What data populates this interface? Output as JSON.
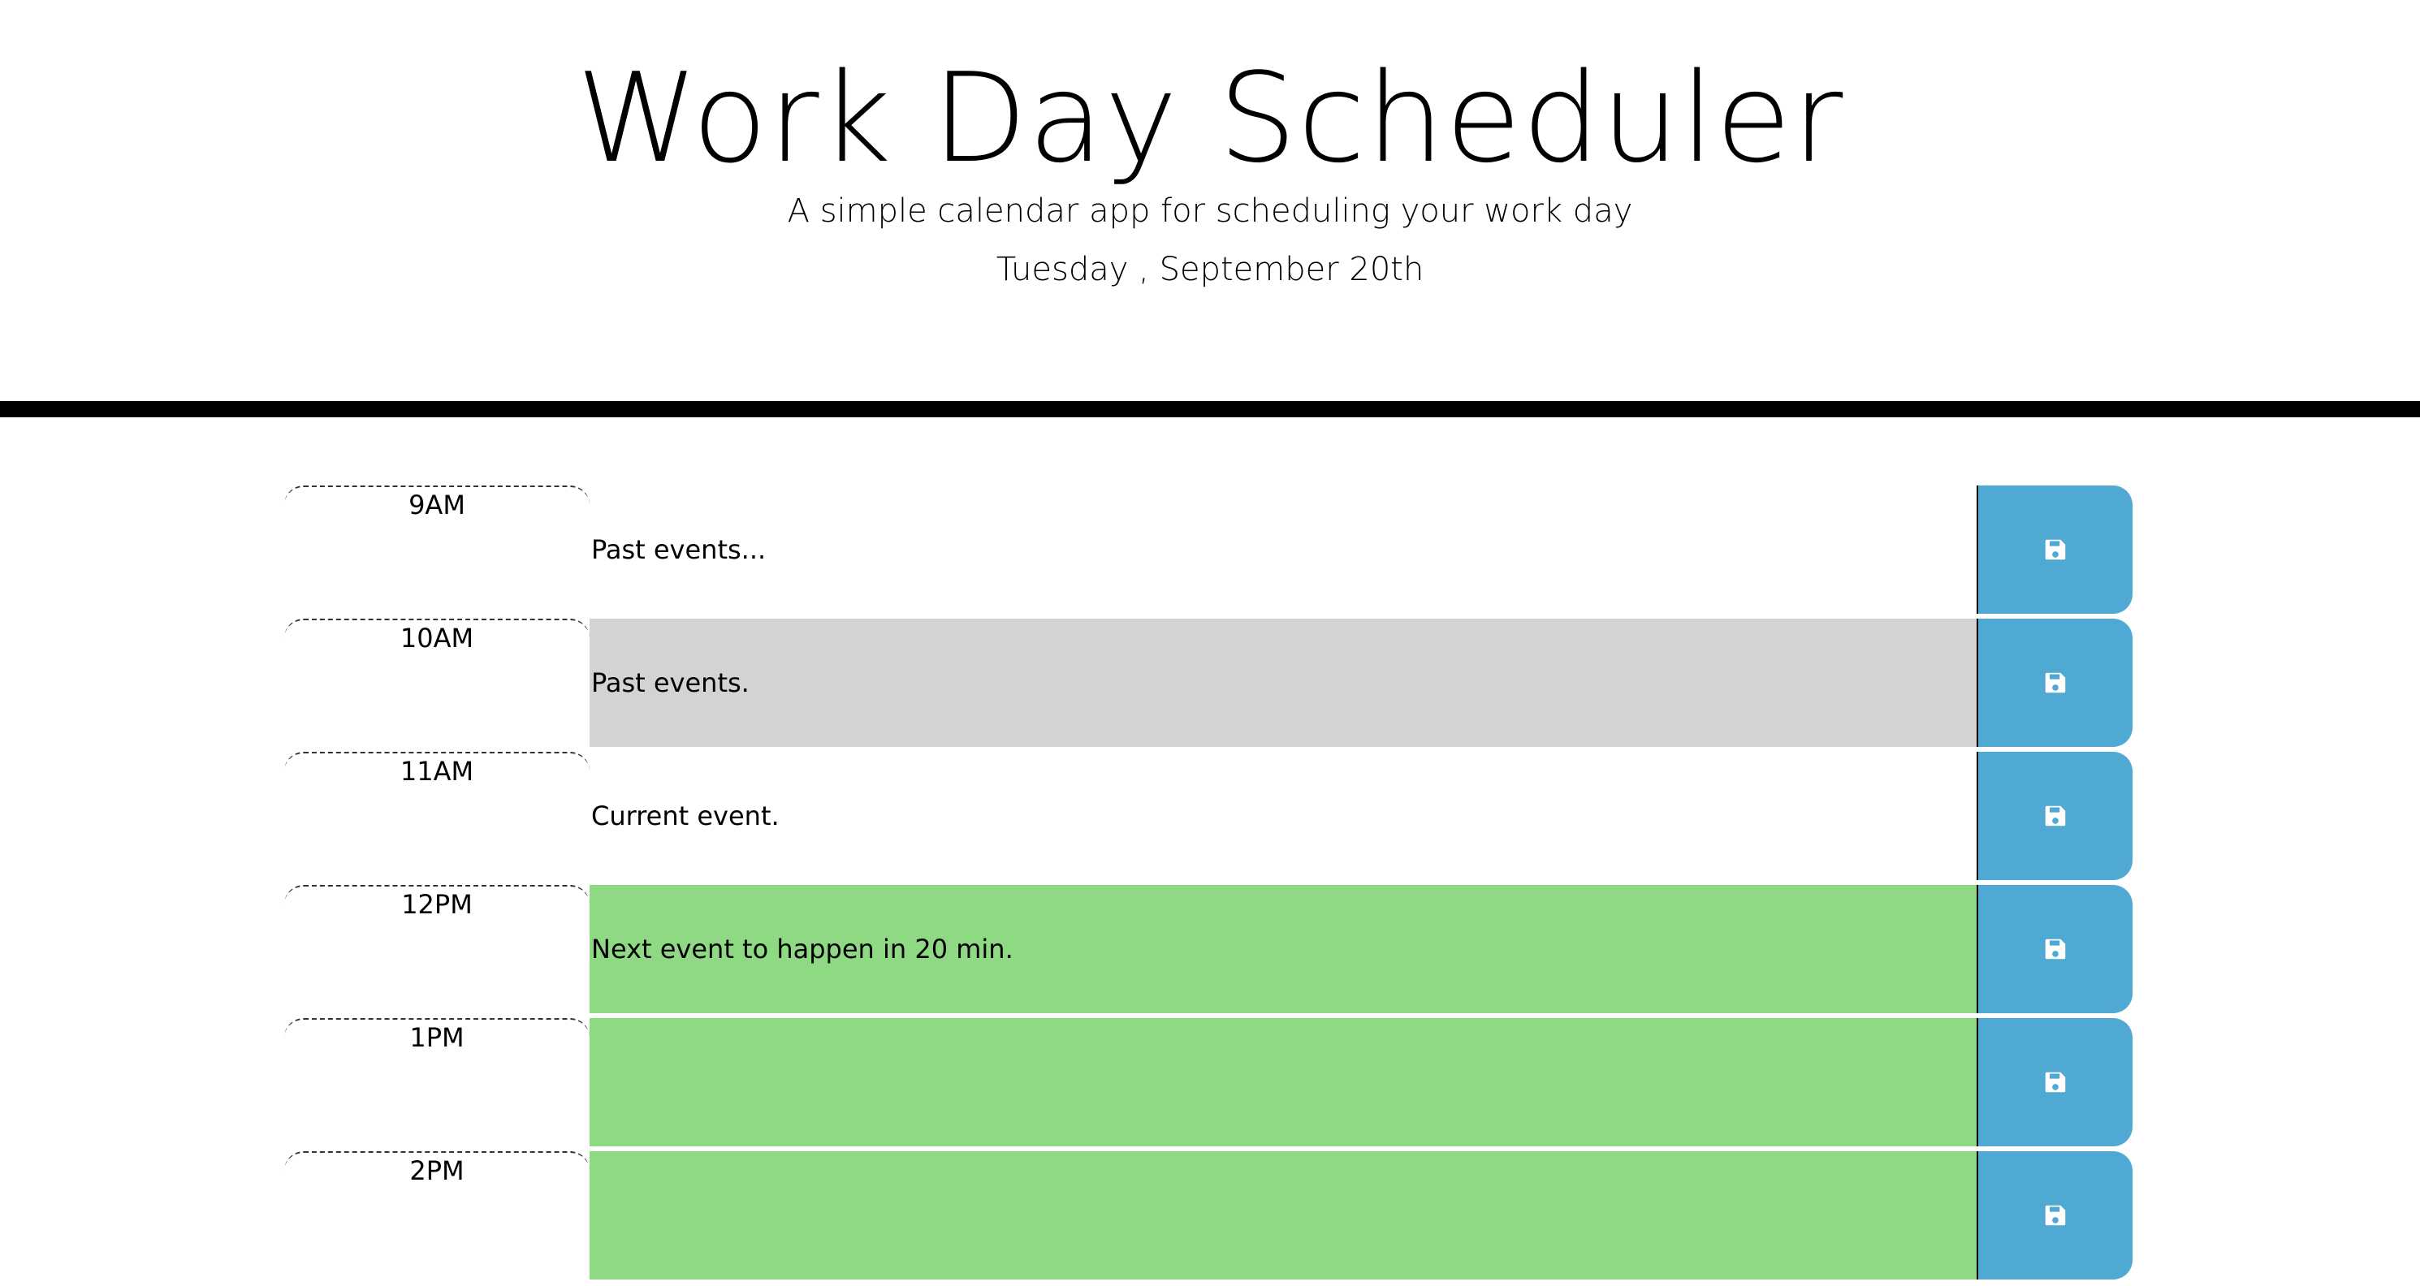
{
  "header": {
    "title": "Work Day Scheduler",
    "subtitle": "A simple calendar app for scheduling your work day",
    "current_day": "Tuesday , September 20th"
  },
  "colors": {
    "past": "#d3d3d3",
    "present": "#ffffff",
    "future": "#8fd985",
    "save_button": "#4fa9d2"
  },
  "time_blocks": [
    {
      "hour": "9AM",
      "text": "Past events...",
      "state": "past"
    },
    {
      "hour": "10AM",
      "text": "Past events.",
      "state": "past"
    },
    {
      "hour": "11AM",
      "text": "Current event.",
      "state": "present"
    },
    {
      "hour": "12PM",
      "text": "Next event to happen in 20 min.",
      "state": "future"
    },
    {
      "hour": "1PM",
      "text": "",
      "state": "future"
    },
    {
      "hour": "2PM",
      "text": "",
      "state": "future"
    }
  ],
  "save_icon": "floppy-disk-icon"
}
